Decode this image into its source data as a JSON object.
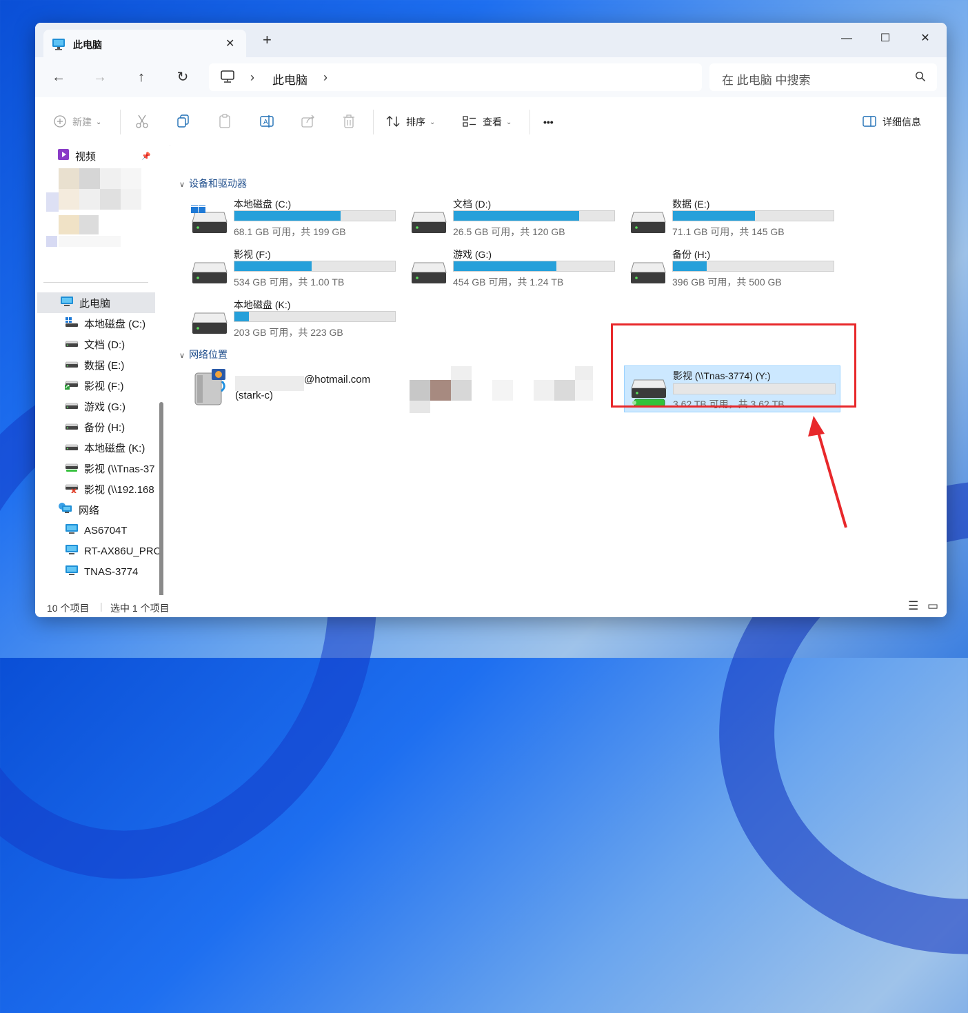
{
  "window": {
    "tab_title": "此电脑",
    "tab_close": "✕",
    "new_tab": "+",
    "minimize": "—",
    "maximize": "☐",
    "close": "✕"
  },
  "nav": {
    "back": "←",
    "forward": "→",
    "up": "↑",
    "refresh": "↻",
    "breadcrumb": [
      "此电脑"
    ],
    "sep": "›",
    "search_placeholder": "在 此电脑 中搜索"
  },
  "toolbar": {
    "new_label": "新建",
    "sort_label": "排序",
    "view_label": "查看",
    "more_label": "•••",
    "details_label": "详细信息"
  },
  "sidebar": {
    "pinned": {
      "label": "视频",
      "pin": "📌"
    },
    "items": [
      {
        "label": "此电脑",
        "icon": "pc-icon",
        "indent": 0,
        "selected": true
      },
      {
        "label": "本地磁盘 (C:)",
        "icon": "windows-drive-icon",
        "indent": 1
      },
      {
        "label": "文档 (D:)",
        "icon": "drive-icon",
        "indent": 1
      },
      {
        "label": "数据 (E:)",
        "icon": "drive-icon",
        "indent": 1
      },
      {
        "label": "影视 (F:)",
        "icon": "shared-drive-icon",
        "indent": 1
      },
      {
        "label": "游戏 (G:)",
        "icon": "drive-icon",
        "indent": 1
      },
      {
        "label": "备份 (H:)",
        "icon": "drive-icon",
        "indent": 1
      },
      {
        "label": "本地磁盘 (K:)",
        "icon": "drive-icon",
        "indent": 1
      },
      {
        "label": "影视 (\\\\Tnas-37",
        "icon": "network-drive-icon",
        "indent": 1
      },
      {
        "label": "影视 (\\\\192.168",
        "icon": "disconnected-drive-icon",
        "indent": 1
      },
      {
        "label": "网络",
        "icon": "network-icon",
        "indent": 0
      },
      {
        "label": "AS6704T",
        "icon": "computer-icon",
        "indent": 1
      },
      {
        "label": "RT-AX86U_PRO",
        "icon": "computer-icon",
        "indent": 1
      },
      {
        "label": "TNAS-3774",
        "icon": "computer-icon",
        "indent": 1
      }
    ]
  },
  "groups": {
    "devices": "设备和驱动器",
    "network": "网络位置",
    "chevron": "∨"
  },
  "drives": [
    {
      "name": "本地磁盘 (C:)",
      "size": "68.1 GB 可用，共 199 GB",
      "used": 0.66,
      "os": true
    },
    {
      "name": "文档 (D:)",
      "size": "26.5 GB 可用，共 120 GB",
      "used": 0.78
    },
    {
      "name": "数据 (E:)",
      "size": "71.1 GB 可用，共 145 GB",
      "used": 0.51
    },
    {
      "name": "影视 (F:)",
      "size": "534 GB 可用，共 1.00 TB",
      "used": 0.48,
      "shared": true
    },
    {
      "name": "游戏 (G:)",
      "size": "454 GB 可用，共 1.24 TB",
      "used": 0.64
    },
    {
      "name": "备份 (H:)",
      "size": "396 GB 可用，共 500 GB",
      "used": 0.21
    },
    {
      "name": "本地磁盘 (K:)",
      "size": "203 GB 可用，共 223 GB",
      "used": 0.09
    }
  ],
  "network_locations": {
    "onedrive": {
      "email": "@hotmail.com",
      "sub": "(stark-c)"
    },
    "selected": {
      "name": "影视 (\\\\Tnas-3774) (Y:)",
      "size": "3.62 TB 可用，共 3.62 TB",
      "used": 0.0
    }
  },
  "status": {
    "count": "10 个项目",
    "selection": "选中 1 个项目",
    "view_list": "☰",
    "view_tiles": "▭"
  },
  "colors": {
    "accent": "#26a0da",
    "annotation": "#e8282b",
    "selection": "#cce8ff"
  }
}
